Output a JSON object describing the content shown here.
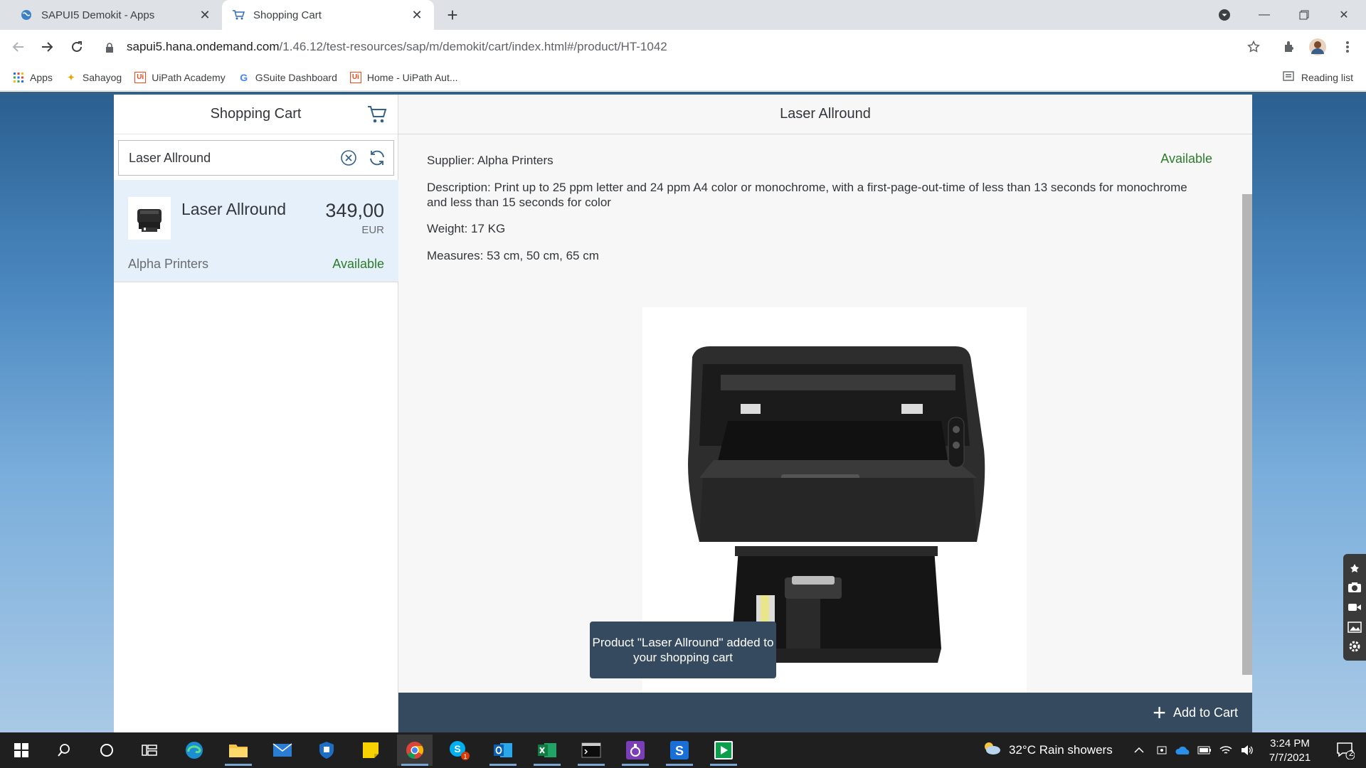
{
  "browser": {
    "tabs": [
      {
        "title": "SAPUI5 Demokit - Apps",
        "active": false
      },
      {
        "title": "Shopping Cart",
        "active": true
      }
    ],
    "url_host": "sapui5.hana.ondemand.com",
    "url_path": "/1.46.12/test-resources/sap/m/demokit/cart/index.html#/product/HT-1042",
    "bookmarks": [
      "Apps",
      "Sahayog",
      "UiPath Academy",
      "GSuite Dashboard",
      "Home - UiPath Aut..."
    ],
    "reading_list": "Reading list"
  },
  "master": {
    "title": "Shopping Cart",
    "search_value": "Laser Allround",
    "item": {
      "name": "Laser Allround",
      "price": "349,00",
      "currency": "EUR",
      "supplier": "Alpha Printers",
      "status": "Available"
    }
  },
  "detail": {
    "title": "Laser Allround",
    "supplier": "Supplier: Alpha Printers",
    "status": "Available",
    "description": "Description: Print up to 25 ppm letter and 24 ppm A4 color or monochrome, with a first-page-out-time of less than 13 seconds for monochrome and less than 15 seconds for color",
    "weight": "Weight: 17 KG",
    "measures": "Measures: 53 cm, 50 cm, 65 cm",
    "toast": "Product \"Laser Allround\" added to your shopping cart",
    "add_to_cart": "Add to Cart"
  },
  "taskbar": {
    "weather": "32°C  Rain showers",
    "time": "3:24 PM",
    "date": "7/7/2021",
    "notifications": "2"
  },
  "colors": {
    "accent": "#346187",
    "footer": "#354a5f",
    "positive": "#2b7d2b",
    "selected": "#e5f0fa"
  }
}
